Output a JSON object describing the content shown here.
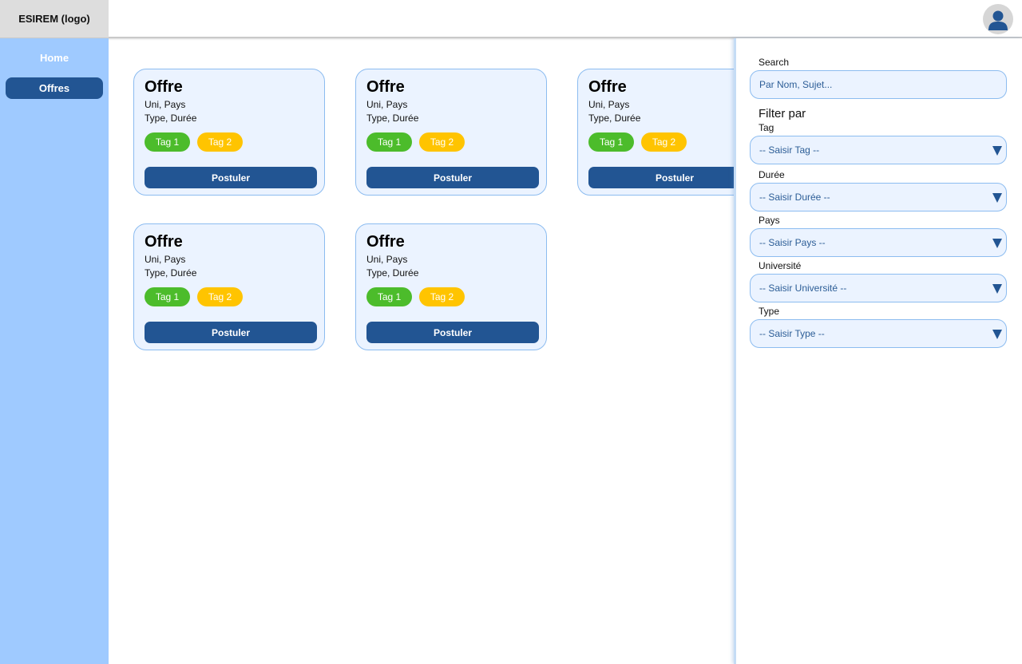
{
  "header": {
    "logo": "ESIREM (logo)",
    "avatar_icon": "user-avatar-icon"
  },
  "sidebar": {
    "items": [
      {
        "label": "Home",
        "active": false
      },
      {
        "label": "Offres",
        "active": true
      }
    ]
  },
  "offers": [
    {
      "title": "Offre",
      "location": "Uni, Pays",
      "details": "Type, Durée",
      "tags": [
        "Tag 1",
        "Tag 2"
      ],
      "button": "Postuler"
    },
    {
      "title": "Offre",
      "location": "Uni, Pays",
      "details": "Type, Durée",
      "tags": [
        "Tag 1",
        "Tag 2"
      ],
      "button": "Postuler"
    },
    {
      "title": "Offre",
      "location": "Uni, Pays",
      "details": "Type, Durée",
      "tags": [
        "Tag 1",
        "Tag 2"
      ],
      "button": "Postuler"
    },
    {
      "title": "Offre",
      "location": "Uni, Pays",
      "details": "Type, Durée",
      "tags": [
        "Tag 1",
        "Tag 2"
      ],
      "button": "Postuler"
    },
    {
      "title": "Offre",
      "location": "Uni, Pays",
      "details": "Type, Durée",
      "tags": [
        "Tag 1",
        "Tag 2"
      ],
      "button": "Postuler"
    }
  ],
  "filters": {
    "search_label": "Search",
    "search_placeholder": "Par Nom, Sujet...",
    "title": "Filter par",
    "fields": [
      {
        "label": "Tag",
        "value": "-- Saisir Tag --"
      },
      {
        "label": "Durée",
        "value": "-- Saisir Durée --"
      },
      {
        "label": "Pays",
        "value": "-- Saisir Pays --"
      },
      {
        "label": "Université",
        "value": "-- Saisir Université --"
      },
      {
        "label": "Type",
        "value": "-- Saisir Type --"
      }
    ]
  },
  "colors": {
    "sidebar_bg": "#9fcaff",
    "primary": "#225593",
    "card_bg": "#ebf3ff",
    "tag1": "#4cbc2b",
    "tag2": "#ffc400"
  }
}
